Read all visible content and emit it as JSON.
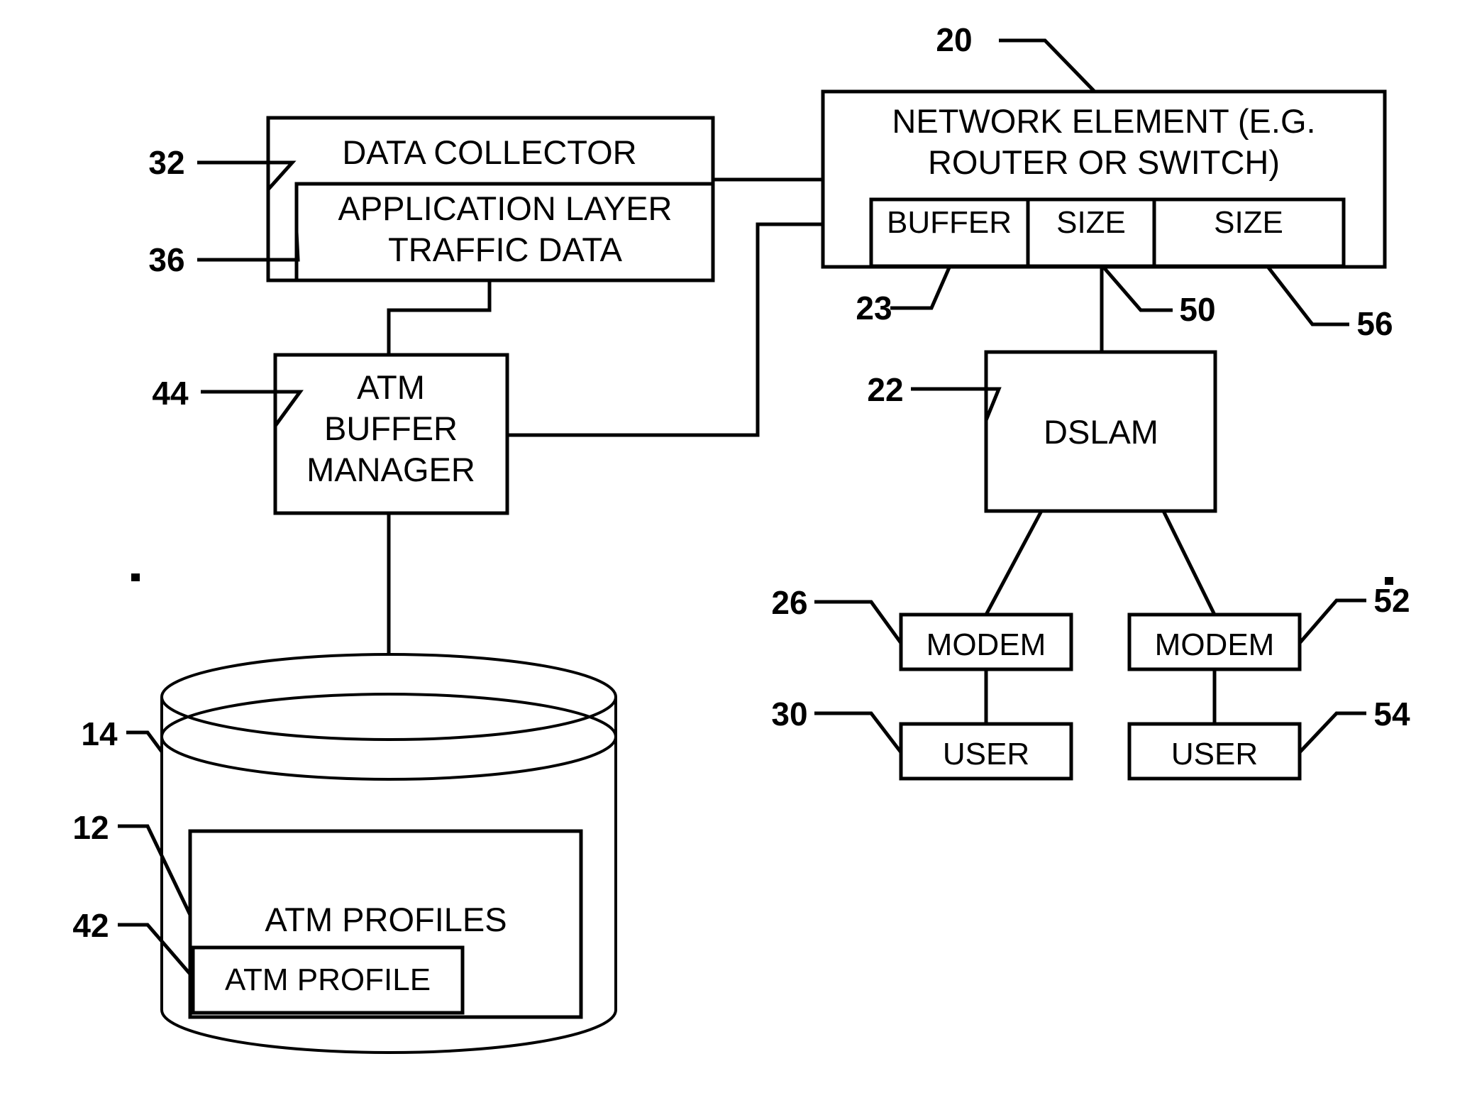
{
  "figure": {
    "title": "Network buffer management block diagram",
    "stroke_color": "#000000",
    "background_color": "#ffffff"
  },
  "boxes": {
    "data_collector": {
      "label": "DATA COLLECTOR",
      "ref": "32"
    },
    "app_layer_traffic_data": {
      "line1": "APPLICATION LAYER",
      "line2": "TRAFFIC DATA",
      "ref": "36"
    },
    "network_element": {
      "line1": "NETWORK ELEMENT (E.G.",
      "line2": "ROUTER OR SWITCH)",
      "ref": "20"
    },
    "buffer_cell": {
      "label": "BUFFER",
      "ref": "23"
    },
    "size_cell_1": {
      "label": "SIZE",
      "ref": "50"
    },
    "size_cell_2": {
      "label": "SIZE",
      "ref": "56"
    },
    "atm_buffer_manager": {
      "line1": "ATM",
      "line2": "BUFFER",
      "line3": "MANAGER",
      "ref": "44"
    },
    "dslam": {
      "label": "DSLAM",
      "ref": "22"
    },
    "modem_left": {
      "label": "MODEM",
      "ref": "26"
    },
    "modem_right": {
      "label": "MODEM",
      "ref": "52"
    },
    "user_left": {
      "label": "USER",
      "ref": "30"
    },
    "user_right": {
      "label": "USER",
      "ref": "54"
    },
    "database": {
      "ref": "14"
    },
    "atm_profiles": {
      "label": "ATM PROFILES",
      "ref": "12"
    },
    "atm_profile": {
      "label": "ATM PROFILE",
      "ref": "42"
    }
  },
  "reference_numerals": [
    {
      "id": "20",
      "text": "20",
      "points_to": "network-element-box"
    },
    {
      "id": "32",
      "text": "32",
      "points_to": "data-collector-box"
    },
    {
      "id": "36",
      "text": "36",
      "points_to": "application-layer-traffic-data-box"
    },
    {
      "id": "23",
      "text": "23",
      "points_to": "buffer-cell"
    },
    {
      "id": "50",
      "text": "50",
      "points_to": "size-cell-1"
    },
    {
      "id": "56",
      "text": "56",
      "points_to": "size-cell-2"
    },
    {
      "id": "44",
      "text": "44",
      "points_to": "atm-buffer-manager-box"
    },
    {
      "id": "22",
      "text": "22",
      "points_to": "dslam-box"
    },
    {
      "id": "26",
      "text": "26",
      "points_to": "modem-left-box"
    },
    {
      "id": "52",
      "text": "52",
      "points_to": "modem-right-box"
    },
    {
      "id": "30",
      "text": "30",
      "points_to": "user-left-box"
    },
    {
      "id": "54",
      "text": "54",
      "points_to": "user-right-box"
    },
    {
      "id": "14",
      "text": "14",
      "points_to": "database-cylinder"
    },
    {
      "id": "12",
      "text": "12",
      "points_to": "atm-profiles-box"
    },
    {
      "id": "42",
      "text": "42",
      "points_to": "atm-profile-box"
    }
  ]
}
